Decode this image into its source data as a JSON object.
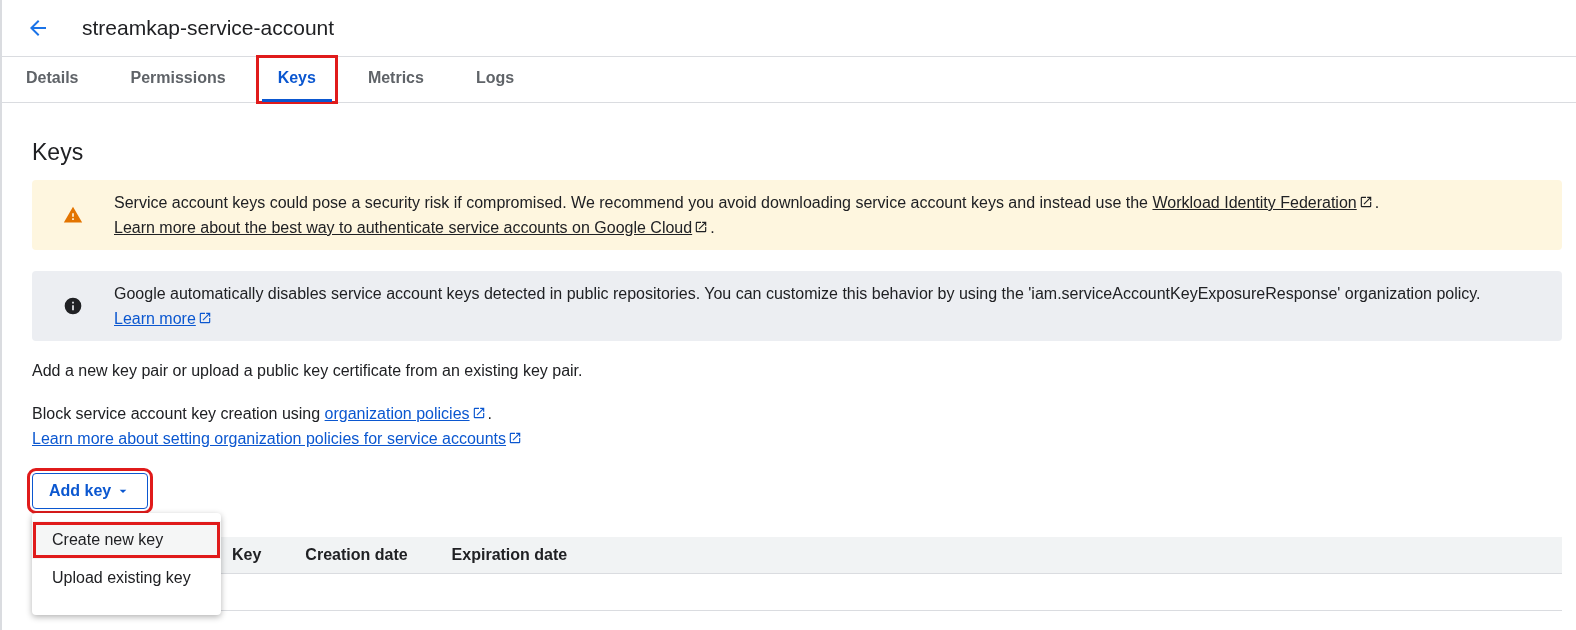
{
  "header": {
    "title": "streamkap-service-account"
  },
  "tabs": [
    {
      "label": "Details",
      "selected": false,
      "highlighted": false
    },
    {
      "label": "Permissions",
      "selected": false,
      "highlighted": false
    },
    {
      "label": "Keys",
      "selected": true,
      "highlighted": true
    },
    {
      "label": "Metrics",
      "selected": false,
      "highlighted": false
    },
    {
      "label": "Logs",
      "selected": false,
      "highlighted": false
    }
  ],
  "section_title": "Keys",
  "banners": [
    {
      "kind": "warning",
      "parts": [
        {
          "kind": "text",
          "text": "Service account keys could pose a security risk if compromised. We recommend you avoid downloading service account keys and instead use the "
        },
        {
          "kind": "link",
          "text": "Workload Identity Federation"
        },
        {
          "kind": "text",
          "text": ". "
        },
        {
          "kind": "link",
          "text": "Learn more about the best way to authenticate service accounts on Google Cloud"
        },
        {
          "kind": "text",
          "text": "."
        }
      ]
    },
    {
      "kind": "info",
      "parts": [
        {
          "kind": "text",
          "text": "Google automatically disables service account keys detected in public repositories. You can customize this behavior by using the 'iam.serviceAccountKeyExposureResponse' organization policy. "
        },
        {
          "kind": "link",
          "text": "Learn more"
        }
      ]
    }
  ],
  "description": "Add a new key pair or upload a public key certificate from an existing key pair.",
  "policy_text": [
    {
      "kind": "text",
      "text": "Block service account key creation using "
    },
    {
      "kind": "link",
      "text": "organization policies"
    },
    {
      "kind": "text",
      "text": "."
    }
  ],
  "policy_link": "Learn more about setting organization policies for service accounts",
  "add_key_button": {
    "label": "Add key",
    "highlighted": true
  },
  "menu": [
    {
      "label": "Create new key",
      "highlighted": true
    },
    {
      "label": "Upload existing key",
      "highlighted": false
    }
  ],
  "table": {
    "columns": [
      "Key",
      "Creation date",
      "Expiration date"
    ]
  }
}
